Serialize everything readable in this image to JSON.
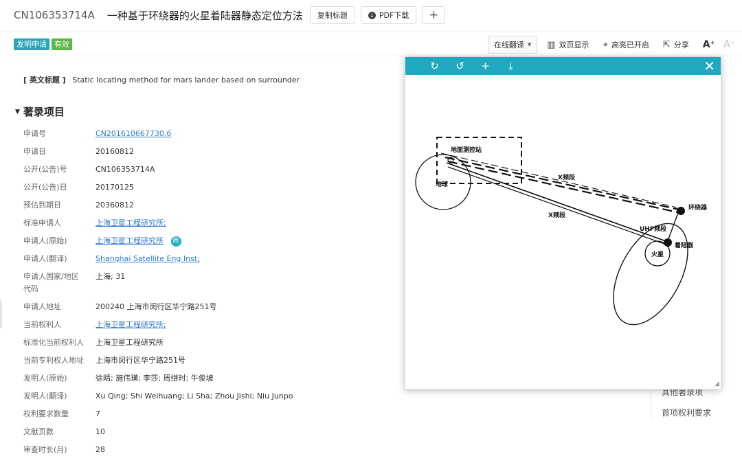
{
  "header": {
    "pub_no": "CN106353714A",
    "title": "一种基于环绕器的火星着陆器静态定位方法",
    "copy_title_btn": "复制标题",
    "pdf_btn": "PDF下载",
    "add_btn": "+"
  },
  "subbar": {
    "type_badge": "发明申请",
    "status_badge": "有效",
    "translate": "在线翻译",
    "dual_page": "双页显示",
    "highlight": "高亮已开启",
    "share": "分享",
    "font_up": "A⁺",
    "font_down": "A⁻"
  },
  "en_title": {
    "label": "[ 英文标题 ]",
    "value": "Static locating method for mars lander based on surrounder"
  },
  "section_title": "著录项目",
  "biblio": [
    {
      "k": "申请号",
      "v": "CN201610667730.6",
      "link": true
    },
    {
      "k": "申请日",
      "v": "20160812"
    },
    {
      "k": "公开(公告)号",
      "v": "CN106353714A"
    },
    {
      "k": "公开(公告)日",
      "v": "20170125"
    },
    {
      "k": "预估到期日",
      "v": "20360812"
    },
    {
      "k": "标准申请人",
      "v": "上海卫星工程研究所;",
      "link": true
    },
    {
      "k": "申请人(原始)",
      "v": "上海卫星工程研究所",
      "link": true,
      "badge": "商"
    },
    {
      "k": "申请人(翻译)",
      "v": "Shanghai Satellite Eng Inst;",
      "link": true
    },
    {
      "k": "申请人国家/地区代码",
      "v": "上海; 31"
    },
    {
      "k": "申请人地址",
      "v": "200240 上海市闵行区华宁路251号"
    },
    {
      "k": "当前权利人",
      "v": "上海卫星工程研究所;",
      "link": true
    },
    {
      "k": "标准化当前权利人",
      "v": "上海卫星工程研究所"
    },
    {
      "k": "当前专利权人地址",
      "v": "上海市闵行区华宁路251号"
    },
    {
      "k": "发明人(原始)",
      "v": "徐晴; 施伟璜; 李莎; 周继时; 牛俊坡"
    },
    {
      "k": "发明人(翻译)",
      "v": "Xu Qing; Shi Weihuang; Li Sha; Zhou Jishi; Niu Junpo"
    },
    {
      "k": "权利要求数量",
      "v": "7"
    },
    {
      "k": "文献页数",
      "v": "10"
    },
    {
      "k": "审查时长(月)",
      "v": "28"
    }
  ],
  "side_nav": {
    "item1": "其他著录项",
    "item2": "首项权利要求"
  },
  "viewer": {
    "icons": [
      "rotate-cw-icon",
      "rotate-ccw-icon",
      "zoom-in-icon",
      "download-icon",
      "close-icon"
    ],
    "figure_labels": {
      "ground_station": "地面测控站",
      "earth": "地球",
      "x_band_upper": "X频段",
      "x_band_lower": "X频段",
      "orbiter": "环绕器",
      "uhf": "UHF频段",
      "lander": "着陆器",
      "mars": "火星"
    }
  }
}
